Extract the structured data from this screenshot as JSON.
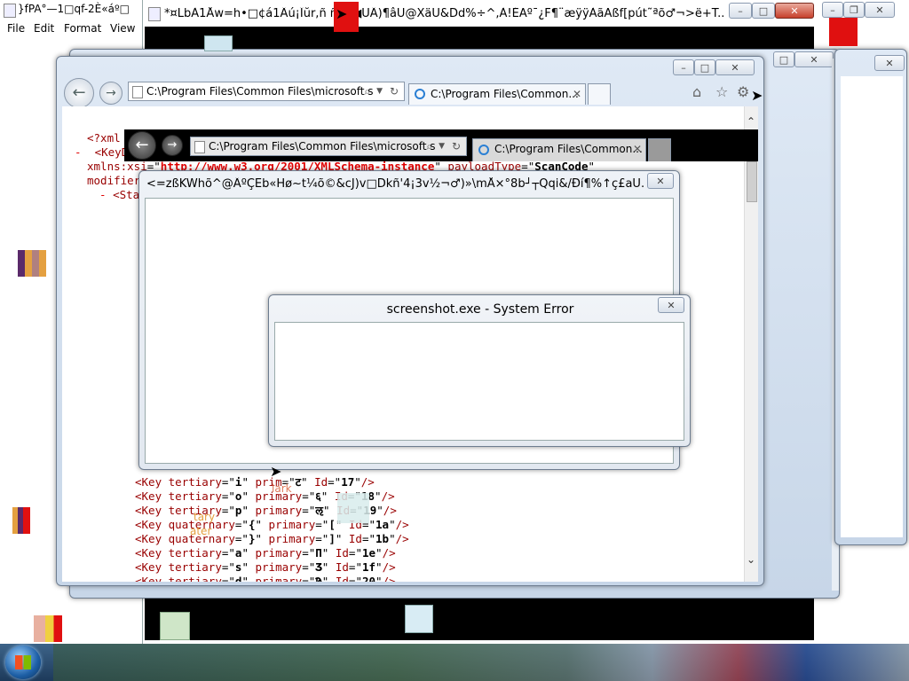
{
  "notepad": {
    "title": "}fPA°—1□qf-2È«áº□",
    "menu": [
      "File",
      "Edit",
      "Format",
      "View"
    ]
  },
  "top_window": {
    "title": "*¤LbÀ1Åw=h•□¢á1Âú¡Îŭr,ñ ñ¶Â◀ÙÂ)¶âÜ@XäÚ&Dd%÷^,À!ÉAº¯¿F¶¨æÿÿÀãÃßf[pút˜ªõ♂¬>ë+T..."
  },
  "ie_back": {
    "address": "C:\\Program Files\\Common Files\\microsoft s",
    "tab_label": "C:\\Program Files\\Common...",
    "xml_pi": "<?xml",
    "key_root": "<KeyD",
    "xmlns_attr": "xmlns:xsi",
    "xmlns_value": "http://www.w3.org/2001/XMLSchema-instance",
    "payload_attr": "payloadType",
    "payload_value": "ScanCode",
    "modifier": "modifier",
    "state_tag": "<Sta",
    "minus": "-",
    "keys": [
      {
        "tag": "<Key ",
        "a1": "tertiary",
        "v1": "i",
        "a2": " prim",
        "v2": "ट",
        "id": "17"
      },
      {
        "tag": "<Key ",
        "a1": "tertiary",
        "v1": "o",
        "a2": " primary",
        "v2": "६",
        "id": "18"
      },
      {
        "tag": "<Key ",
        "a1": "tertiary",
        "v1": "p",
        "a2": " primary",
        "v2": "ऌ",
        "id": "19"
      },
      {
        "tag": "<Key ",
        "a1": "quaternary",
        "v1": "{",
        "a2": " primary",
        "v2": "[",
        "id": "1a"
      },
      {
        "tag": "<Key ",
        "a1": "quaternary",
        "v1": "}",
        "a2": " primary",
        "v2": "]",
        "id": "1b"
      },
      {
        "tag": "<Key ",
        "a1": "tertiary",
        "v1": "a",
        "a2": " primary",
        "v2": "Π",
        "id": "1e"
      },
      {
        "tag": "<Key ",
        "a1": "tertiary",
        "v1": "s",
        "a2": " primary",
        "v2": "Ʒ",
        "id": "1f"
      },
      {
        "tag": "<Key ",
        "a1": "tertiary",
        "v1": "d",
        "a2": " primary",
        "v2": "Ϡ",
        "id": "20"
      }
    ]
  },
  "ie_front": {
    "address": "C:\\Program Files\\Common Files\\microsoft s",
    "tab_label": "C:\\Program Files\\Common..."
  },
  "garbled_dialog": {
    "title": "<=zßKWhõ^@ÂºÇËb«Hø~t¼õ©&cJ)v□Dkñ'4¡3v½¬♂)»\\mÅ×°8b┘┬Qqi&/Ðí¶%↑ç£aÚ..."
  },
  "error_dialog": {
    "title": "screenshot.exe - System Error"
  },
  "glitch_text": {
    "a": "tary",
    "b": "ater",
    "c": "lark"
  },
  "colors": {
    "glitch_red": "#e01010",
    "glitch_orange": "#e4a040",
    "glitch_purple": "#5a2a6a",
    "taskbar_bg": "#2b4a6e",
    "window_frame": "#c7d6e8"
  }
}
